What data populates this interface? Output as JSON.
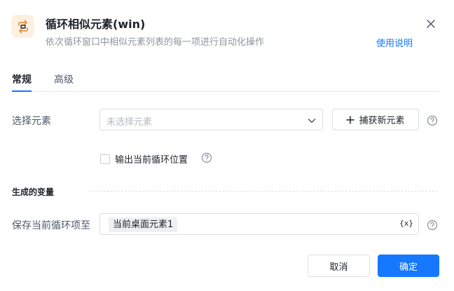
{
  "header": {
    "title": "循环相似元素(win)",
    "subtitle": "依次循环窗口中相似元素列表的每一项进行自动化操作",
    "help_link": "使用说明",
    "icon": "loop-icon",
    "icon_bg_color": "#fdf0e2",
    "icon_color": "#e8943a"
  },
  "tabs": [
    {
      "label": "常规",
      "active": true
    },
    {
      "label": "高级",
      "active": false
    }
  ],
  "fields": {
    "select_element": {
      "label": "选择元素",
      "placeholder": "未选择元素",
      "capture_button": "捕获新元素"
    },
    "output_position": {
      "label": "输出当前循环位置",
      "checked": false
    }
  },
  "section": {
    "title": "生成的变量"
  },
  "output_var": {
    "label": "保存当前循环项至",
    "value": "当前桌面元素1",
    "var_button": "{x}"
  },
  "footer": {
    "cancel": "取消",
    "ok": "确定"
  },
  "colors": {
    "accent": "#1677ff",
    "border": "#dcdfe6",
    "muted_text": "#8f959e"
  }
}
